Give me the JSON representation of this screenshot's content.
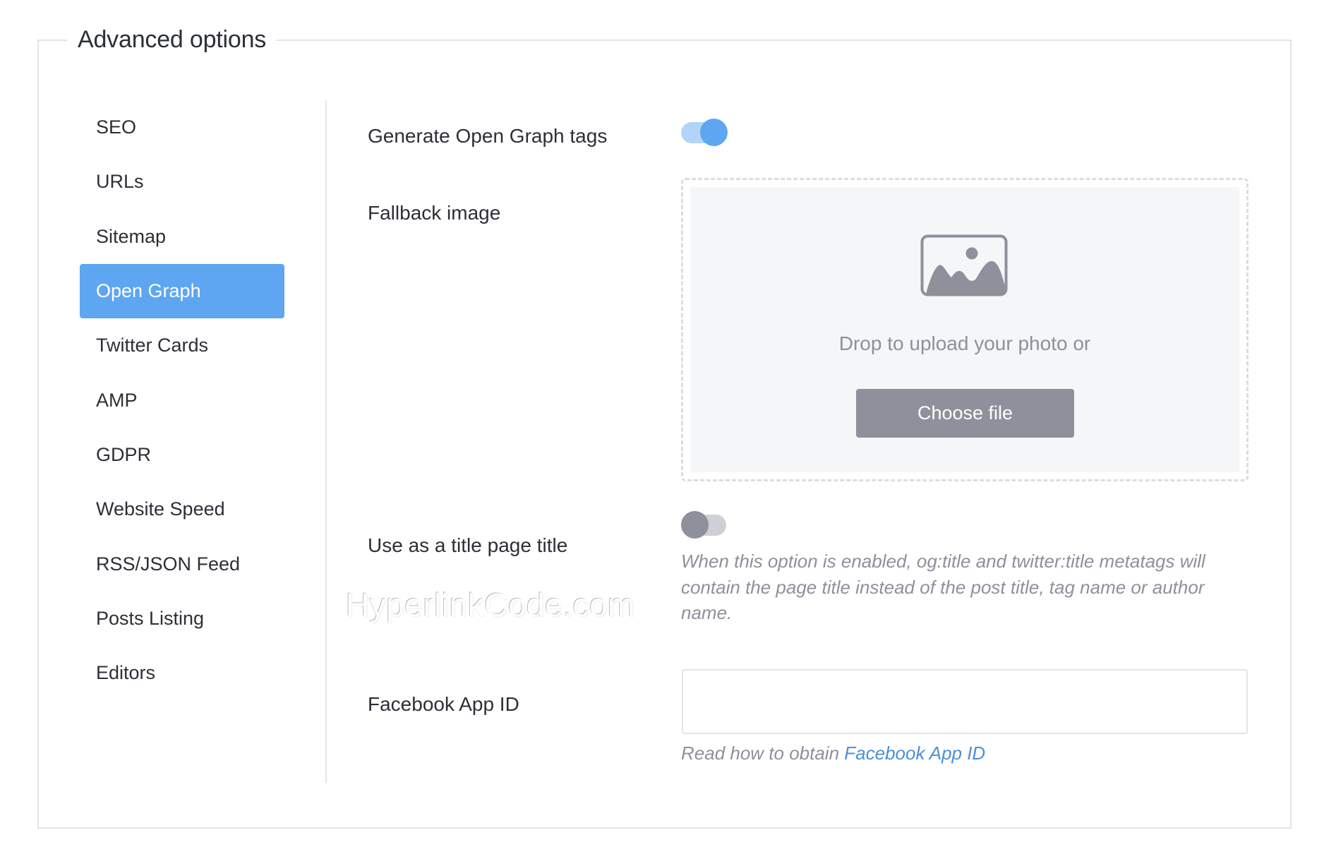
{
  "panel": {
    "title": "Advanced options"
  },
  "sidebar": {
    "items": [
      {
        "label": "SEO",
        "active": false
      },
      {
        "label": "URLs",
        "active": false
      },
      {
        "label": "Sitemap",
        "active": false
      },
      {
        "label": "Open Graph",
        "active": true
      },
      {
        "label": "Twitter Cards",
        "active": false
      },
      {
        "label": "AMP",
        "active": false
      },
      {
        "label": "GDPR",
        "active": false
      },
      {
        "label": "Website Speed",
        "active": false
      },
      {
        "label": "RSS/JSON Feed",
        "active": false
      },
      {
        "label": "Posts Listing",
        "active": false
      },
      {
        "label": "Editors",
        "active": false
      }
    ]
  },
  "settings": {
    "generate_og": {
      "label": "Generate Open Graph tags",
      "enabled": true
    },
    "fallback_image": {
      "label": "Fallback image",
      "icon": "image-icon",
      "drop_text": "Drop to upload your photo or",
      "button_label": "Choose file"
    },
    "use_title": {
      "label": "Use as a title page title",
      "enabled": false,
      "help": "When this option is enabled, og:title and twitter:title metatags will contain the page title instead of the post title, tag name or author name."
    },
    "facebook_app_id": {
      "label": "Facebook App ID",
      "value": "",
      "placeholder": "",
      "help_prefix": "Read how to obtain ",
      "help_link": "Facebook App ID"
    }
  },
  "colors": {
    "accent": "#5ea6f1",
    "link": "#4a90d9",
    "muted": "#8e909b"
  },
  "watermark": "HyperlinkCode.com"
}
